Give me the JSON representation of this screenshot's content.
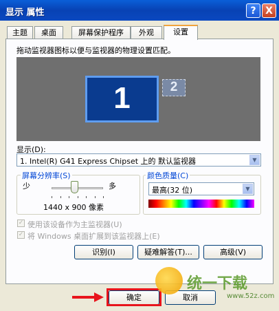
{
  "window": {
    "title": "显示 属性",
    "help_btn": "?",
    "close_btn": "X"
  },
  "tabs": [
    {
      "label": "主题"
    },
    {
      "label": "桌面"
    },
    {
      "label": "屏幕保护程序"
    },
    {
      "label": "外观"
    },
    {
      "label": "设置"
    }
  ],
  "settings": {
    "instruction": "拖动监视器图标以便与监视器的物理设置匹配。",
    "monitors": [
      {
        "number": "1"
      },
      {
        "number": "2"
      }
    ],
    "display_label": "显示(D):",
    "display_value": "1. Intel(R) G41 Express Chipset 上的 默认监视器",
    "resolution": {
      "group_title": "屏幕分辨率(S)",
      "min_label": "少",
      "max_label": "多",
      "value": "1440 x 900 像素",
      "slider_position": 0.45
    },
    "color_quality": {
      "group_title": "颜色质量(C)",
      "selected": "最高(32 位)"
    },
    "checkbox_primary": "使用该设备作为主监视器(U)",
    "checkbox_extend": "将 Windows 桌面扩展到该监视器上(E)",
    "buttons": {
      "identify": "识别(I)",
      "troubleshoot": "疑难解答(T)...",
      "advanced": "高级(V)"
    }
  },
  "footer": {
    "ok": "确定",
    "cancel": "取消"
  },
  "watermark": {
    "text": "统一下载",
    "url": "www.52z.com"
  },
  "colors": {
    "titlebar": "#0842b4",
    "highlight": "#e8141c",
    "monitor_primary": "#0a3b8f",
    "tab_active": "#f0a33c"
  }
}
